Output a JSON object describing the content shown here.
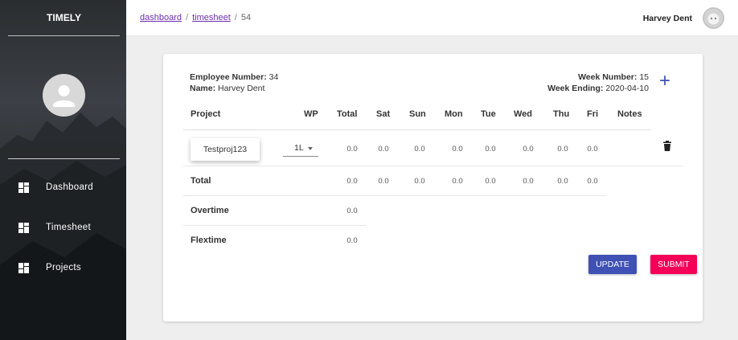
{
  "app": {
    "brand": "TIMELY"
  },
  "sidebar": {
    "items": [
      {
        "label": "Dashboard",
        "icon": "dashboard-icon"
      },
      {
        "label": "Timesheet",
        "icon": "dashboard-icon"
      },
      {
        "label": "Projects",
        "icon": "dashboard-icon"
      }
    ]
  },
  "header": {
    "breadcrumb": [
      {
        "label": "dashboard"
      },
      {
        "label": "timesheet"
      },
      {
        "label": "54"
      }
    ],
    "user_name": "Harvey Dent"
  },
  "timesheet": {
    "employee_number_label": "Employee Number:",
    "employee_number": "34",
    "name_label": "Name:",
    "name": "Harvey Dent",
    "week_number_label": "Week Number:",
    "week_number": "15",
    "week_ending_label": "Week Ending:",
    "week_ending": "2020-04-10",
    "add_label": "+",
    "columns": [
      "Project",
      "WP",
      "Total",
      "Sat",
      "Sun",
      "Mon",
      "Tue",
      "Wed",
      "Thu",
      "Fri",
      "Notes"
    ],
    "rows": [
      {
        "project": "Testproj123",
        "wp": "1L",
        "values": [
          "0.0",
          "0.0",
          "0.0",
          "0.0",
          "0.0",
          "0.0",
          "0.0",
          "0.0"
        ]
      }
    ],
    "total": {
      "label": "Total",
      "values": [
        "0.0",
        "0.0",
        "0.0",
        "0.0",
        "0.0",
        "0.0",
        "0.0",
        "0.0"
      ]
    },
    "overtime": {
      "label": "Overtime",
      "value": "0.0"
    },
    "flextime": {
      "label": "Flextime",
      "value": "0.0"
    }
  },
  "actions": {
    "update_label": "UPDATE",
    "submit_label": "SUBMIT"
  },
  "colors": {
    "primary": "#3f51b5",
    "secondary": "#f50057",
    "link": "#6a2fae"
  }
}
